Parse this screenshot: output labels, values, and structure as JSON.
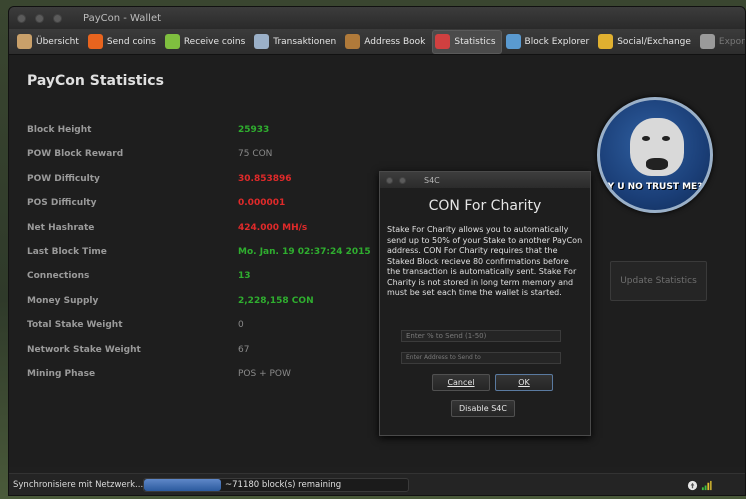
{
  "window": {
    "title": "PayCon - Wallet"
  },
  "toolbar": {
    "items": [
      {
        "label": "Übersicht",
        "icon": "overview-icon",
        "color": "#c9a06a"
      },
      {
        "label": "Send coins",
        "icon": "send-rocket-icon",
        "color": "#e8641e"
      },
      {
        "label": "Receive coins",
        "icon": "receive-parachute-icon",
        "color": "#7fbf3f"
      },
      {
        "label": "Transaktionen",
        "icon": "transactions-icon",
        "color": "#9bb0c8"
      },
      {
        "label": "Address Book",
        "icon": "address-book-icon",
        "color": "#b07a3a"
      },
      {
        "label": "Statistics",
        "icon": "statistics-pie-icon",
        "color": "#d04040"
      },
      {
        "label": "Block Explorer",
        "icon": "block-explorer-grid-icon",
        "color": "#5a9ad0"
      },
      {
        "label": "Social/Exchange",
        "icon": "social-people-icon",
        "color": "#e0b030"
      }
    ],
    "overflow_label": "Export",
    "active": "Statistics"
  },
  "page": {
    "title": "PayCon Statistics"
  },
  "stats": [
    {
      "label": "Block Height",
      "value": "25933",
      "status": "green"
    },
    {
      "label": "POW Block Reward",
      "value": "75 CON",
      "status": "grey"
    },
    {
      "label": "POW Difficulty",
      "value": "30.853896",
      "status": "red"
    },
    {
      "label": "POS Difficulty",
      "value": "0.000001",
      "status": "red"
    },
    {
      "label": "Net Hashrate",
      "value": "424.000 MH/s",
      "status": "red"
    },
    {
      "label": "Last Block Time",
      "value": "Mo. Jan. 19 02:37:24 2015",
      "status": "green"
    },
    {
      "label": "Connections",
      "value": "13",
      "status": "green"
    },
    {
      "label": "Money Supply",
      "value": "2,228,158 CON",
      "status": "green"
    },
    {
      "label": "Total Stake Weight",
      "value": "0",
      "status": "grey"
    },
    {
      "label": "Network Stake Weight",
      "value": "67",
      "status": "grey"
    },
    {
      "label": "Mining Phase",
      "value": "POS + POW",
      "status": "grey"
    }
  ],
  "avatar": {
    "caption": "Y U NO TRUST ME?"
  },
  "update_button": {
    "label": "Update Statistics"
  },
  "dialog": {
    "window_title": "S4C",
    "heading": "CON For Charity",
    "description": "Stake For Charity allows you to automatically send up to 50% of your Stake to another PayCon address.  CON For Charity requires that the Staked Block recieve 80 confirmations before the transaction is automatically sent. Stake For Charity is not stored in long term memory and must be set each time the wallet is started.",
    "percent_placeholder": "Enter % to Send (1-50)",
    "address_placeholder": "Enter Address to Send to",
    "cancel_label": "Cancel",
    "ok_label": "OK",
    "disable_label": "Disable S4C"
  },
  "statusbar": {
    "sync_text": "Synchronisiere mit Netzwerk...",
    "progress_text": "~71180 block(s) remaining",
    "progress_fraction": 0.29
  },
  "colors": {
    "green": "#2fae2f",
    "red": "#e02a2a",
    "grey": "#8a8a8a"
  }
}
